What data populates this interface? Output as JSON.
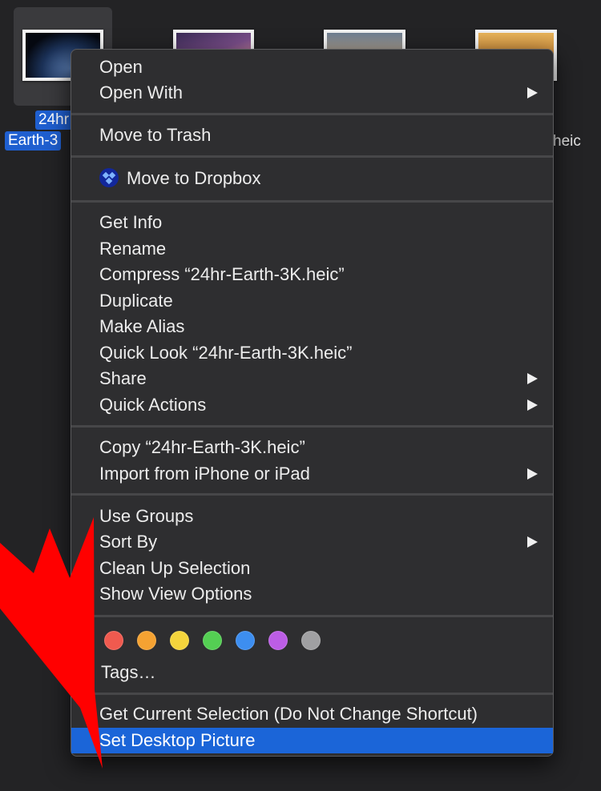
{
  "desktop": {
    "file_label_line1": "24hr",
    "file_label_line2": "Earth-3",
    "side_text": "heic"
  },
  "menu": {
    "groups": [
      {
        "items": [
          {
            "label": "Open"
          },
          {
            "label": "Open With",
            "submenu": true
          }
        ]
      },
      {
        "items": [
          {
            "label": "Move to Trash"
          }
        ]
      },
      {
        "items": [
          {
            "label": "Move to Dropbox",
            "icon": "dropbox-icon"
          }
        ]
      },
      {
        "items": [
          {
            "label": "Get Info"
          },
          {
            "label": "Rename"
          },
          {
            "label": "Compress “24hr-Earth-3K.heic”"
          },
          {
            "label": "Duplicate"
          },
          {
            "label": "Make Alias"
          },
          {
            "label": "Quick Look “24hr-Earth-3K.heic”"
          },
          {
            "label": "Share",
            "submenu": true
          },
          {
            "label": "Quick Actions",
            "submenu": true
          }
        ]
      },
      {
        "items": [
          {
            "label": "Copy “24hr-Earth-3K.heic”"
          },
          {
            "label": "Import from iPhone or iPad",
            "submenu": true
          }
        ]
      },
      {
        "items": [
          {
            "label": "Use Groups"
          },
          {
            "label": "Sort By",
            "submenu": true
          },
          {
            "label": "Clean Up Selection"
          },
          {
            "label": "Show View Options"
          }
        ]
      }
    ],
    "tag_colors": [
      "#f05a4f",
      "#f5a232",
      "#f5d53c",
      "#54cf53",
      "#3d8ef0",
      "#bc5de6",
      "#a0a0a2"
    ],
    "tag_names": [
      "red-tag",
      "orange-tag",
      "yellow-tag",
      "green-tag",
      "blue-tag",
      "purple-tag",
      "gray-tag"
    ],
    "tags_label": "Tags…",
    "bottom_items": [
      {
        "label": "Get Current Selection (Do Not Change Shortcut)"
      },
      {
        "label": "Set Desktop Picture",
        "highlighted": true
      }
    ],
    "highlight_color": "#1b65d8"
  },
  "annotation": {
    "color": "#ff0000",
    "icon": "red-arrow"
  }
}
